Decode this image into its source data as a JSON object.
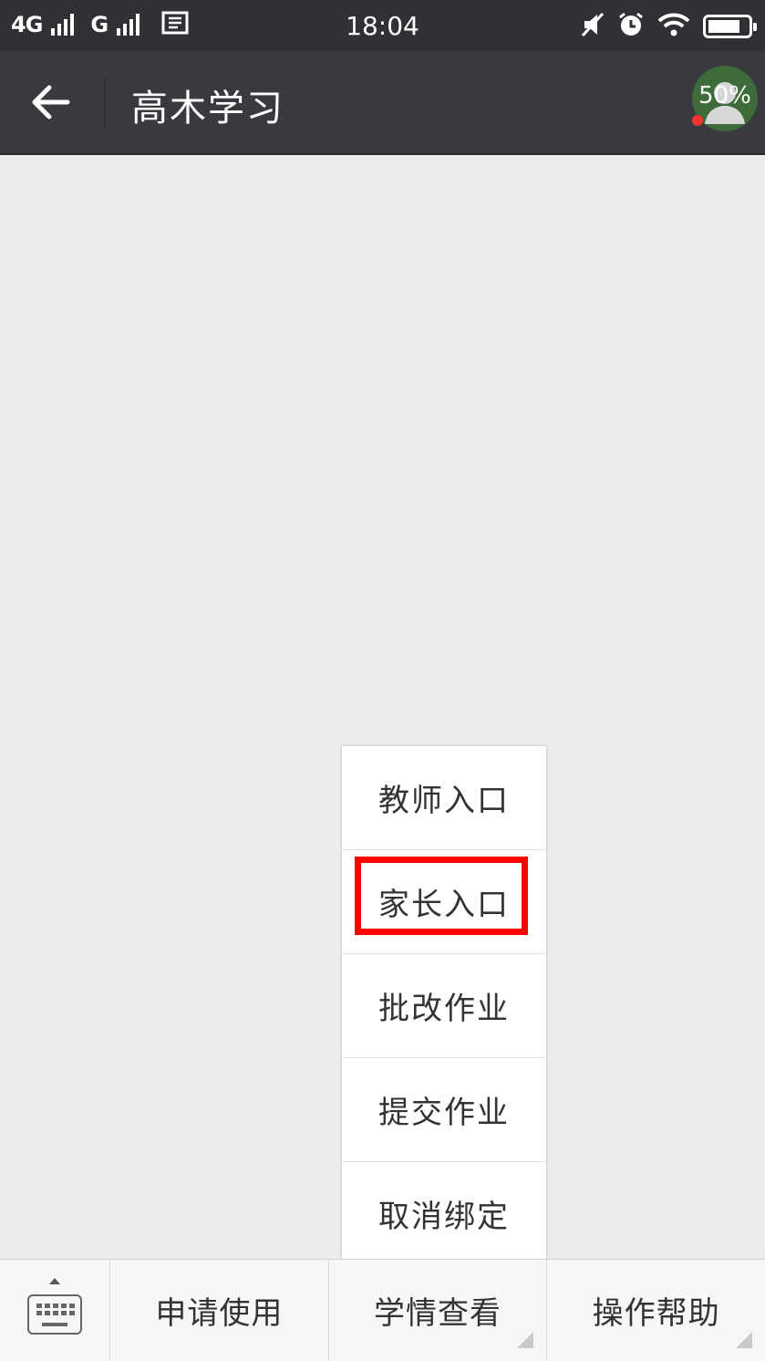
{
  "status_bar": {
    "carrier1": "4G",
    "carrier2": "G",
    "time": "18:04",
    "battery_level": 0.8
  },
  "nav_bar": {
    "title": "高木学习",
    "profile_badge": "50%"
  },
  "popup_menu": {
    "items": [
      "教师入口",
      "家长入口",
      "批改作业",
      "提交作业",
      "取消绑定"
    ],
    "highlighted_index": 1,
    "highlight_color": "#ff0000"
  },
  "bottom_menu": {
    "tabs": [
      "申请使用",
      "学情查看",
      "操作帮助"
    ]
  },
  "colors": {
    "header_bg": "#393a3f",
    "status_bg": "#303135",
    "page_bg": "#ececec",
    "notification_dot": "#f43530"
  }
}
